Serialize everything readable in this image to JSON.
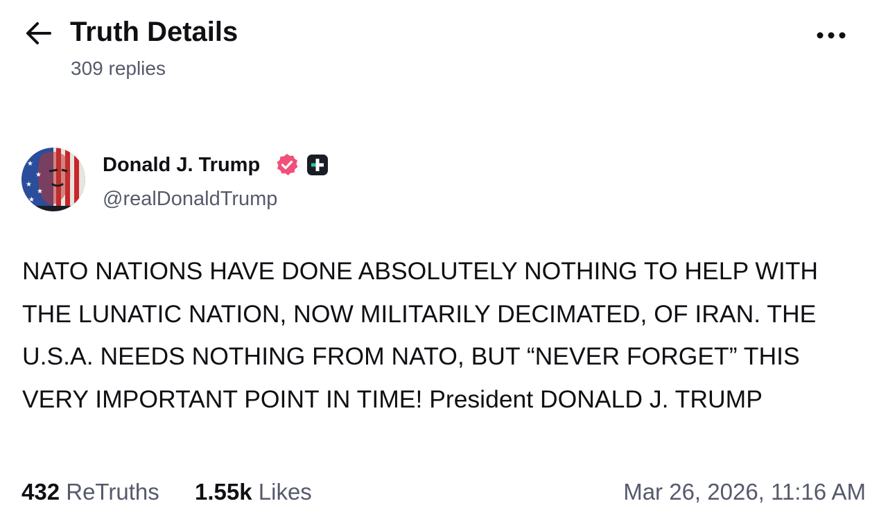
{
  "header": {
    "title": "Truth Details",
    "reply_count": "309 replies",
    "back_icon": "arrow-left-icon",
    "more_icon": "more-horizontal-icon"
  },
  "author": {
    "display_name": "Donald J. Trump",
    "handle": "@realDonaldTrump",
    "verified_badge_color": "#f0507a",
    "plus_badge_color": "#1a1d26",
    "plus_badge_accent": "#23c8a8"
  },
  "post": {
    "text": "NATO NATIONS HAVE DONE ABSOLUTELY NOTHING TO HELP WITH THE LUNATIC NATION, NOW MILITARILY DECIMATED, OF IRAN. THE U.S.A. NEEDS NOTHING FROM NATO, BUT “NEVER FORGET” THIS VERY IMPORTANT POINT IN TIME! President DONALD J. TRUMP"
  },
  "stats": {
    "retruths_count": "432",
    "retruths_label": "ReTruths",
    "likes_count": "1.55k",
    "likes_label": "Likes",
    "timestamp": "Mar 26, 2026, 11:16 AM"
  }
}
